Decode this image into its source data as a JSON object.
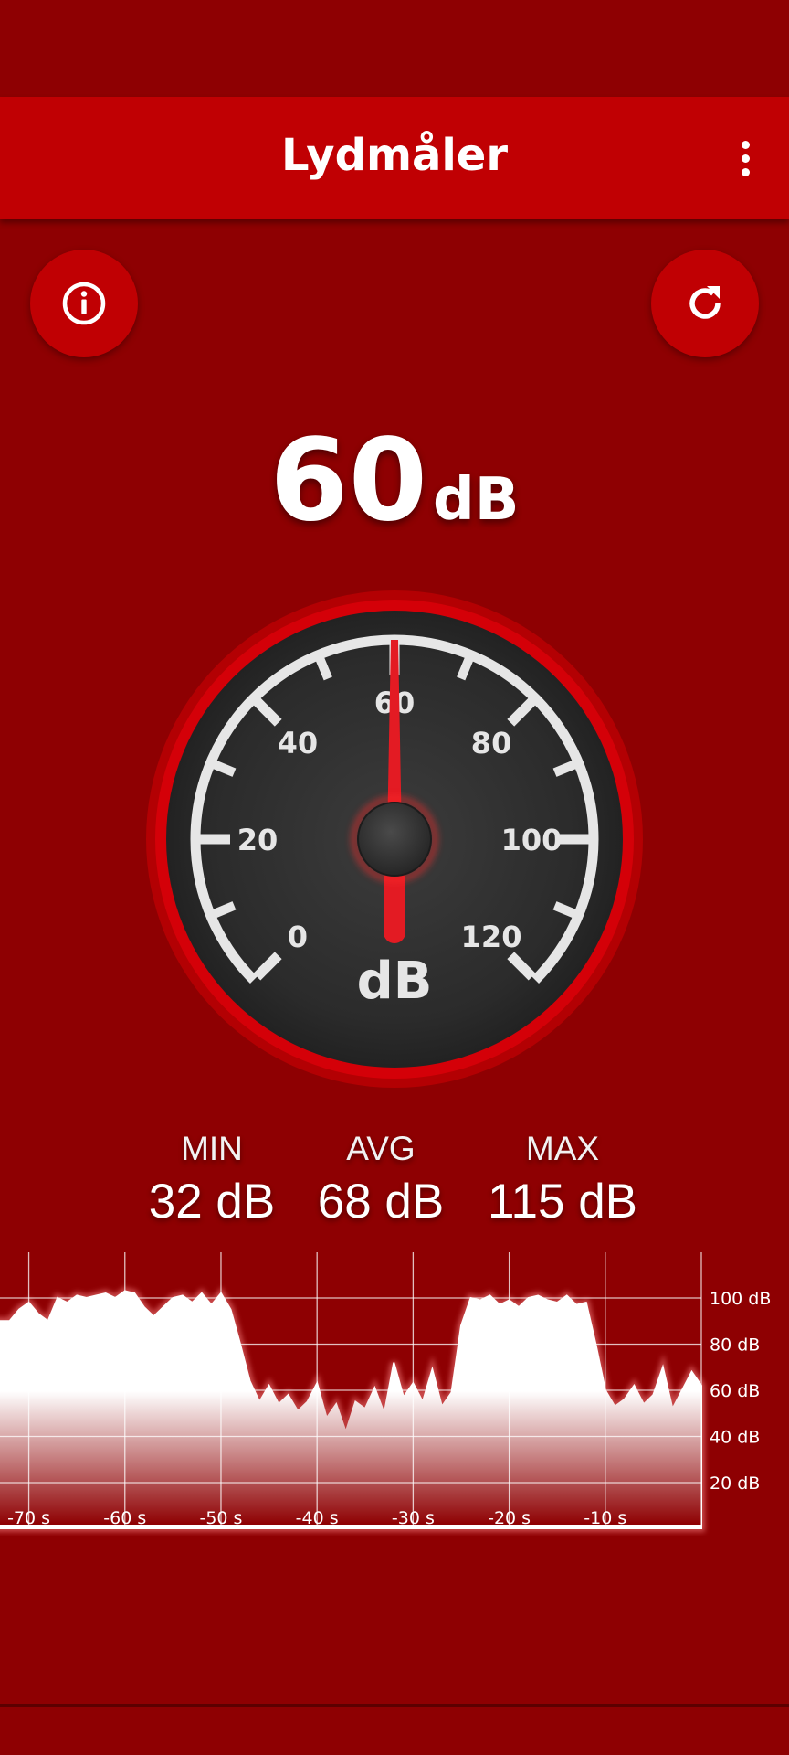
{
  "app_bar": {
    "title": "Lydmåler",
    "menu_icon": "more-vert-icon"
  },
  "actions": {
    "info_icon": "info-icon",
    "reset_icon": "refresh-icon"
  },
  "reading": {
    "value": "60",
    "unit": "dB",
    "numeric": 60
  },
  "gauge": {
    "min": 0,
    "max": 120,
    "value": 60,
    "tick_labels": [
      "0",
      "20",
      "40",
      "60",
      "80",
      "100",
      "120"
    ],
    "unit_label": "dB",
    "needle_color": "#e31b23"
  },
  "stats": {
    "min": {
      "label": "MIN",
      "value": "32 dB"
    },
    "avg": {
      "label": "AVG",
      "value": "68 dB"
    },
    "max": {
      "label": "MAX",
      "value": "115 dB"
    }
  },
  "chart_data": {
    "type": "area",
    "x": [
      -75,
      -73,
      -72,
      -71,
      -70,
      -69,
      -68,
      -67,
      -66,
      -65,
      -64,
      -63,
      -62,
      -61,
      -60,
      -59,
      -58,
      -57,
      -56,
      -55,
      -54,
      -53,
      -52,
      -51,
      -50,
      -49,
      -48,
      -47,
      -46,
      -45,
      -44,
      -43,
      -42,
      -41,
      -40,
      -39,
      -38,
      -37,
      -36,
      -35,
      -34,
      -33,
      -32,
      -31,
      -30,
      -29,
      -28,
      -27,
      -26,
      -25,
      -24,
      -23,
      -22,
      -21,
      -20,
      -19,
      -18,
      -17,
      -16,
      -15,
      -14,
      -13,
      -12,
      -11,
      -10,
      -9,
      -8,
      -7,
      -6,
      -5,
      -4,
      -3,
      -2,
      -1,
      0
    ],
    "y": [
      90,
      90,
      90,
      95,
      98,
      93,
      90,
      100,
      98,
      101,
      100,
      101,
      102,
      100,
      103,
      102,
      96,
      92,
      96,
      100,
      101,
      98,
      102,
      97,
      102,
      95,
      80,
      64,
      55,
      62,
      54,
      58,
      51,
      55,
      63,
      48,
      54,
      42,
      55,
      52,
      61,
      50,
      72,
      57,
      63,
      55,
      69,
      53,
      59,
      88,
      100,
      99,
      101,
      97,
      99,
      96,
      100,
      101,
      99,
      98,
      101,
      97,
      98,
      80,
      60,
      53,
      56,
      62,
      54,
      58,
      70,
      52,
      60,
      68,
      62
    ],
    "xlabel": "",
    "ylabel": "",
    "x_tick_labels": [
      "-70 s",
      "-60 s",
      "-50 s",
      "-40 s",
      "-30 s",
      "-20 s",
      "-10 s"
    ],
    "x_ticks": [
      -70,
      -60,
      -50,
      -40,
      -30,
      -20,
      -10
    ],
    "y_tick_labels": [
      "20 dB",
      "40 dB",
      "60 dB",
      "80 dB",
      "100 dB"
    ],
    "y_ticks": [
      20,
      40,
      60,
      80,
      100
    ],
    "xlim": [
      -73,
      0
    ],
    "ylim": [
      0,
      120
    ],
    "grid": true
  }
}
